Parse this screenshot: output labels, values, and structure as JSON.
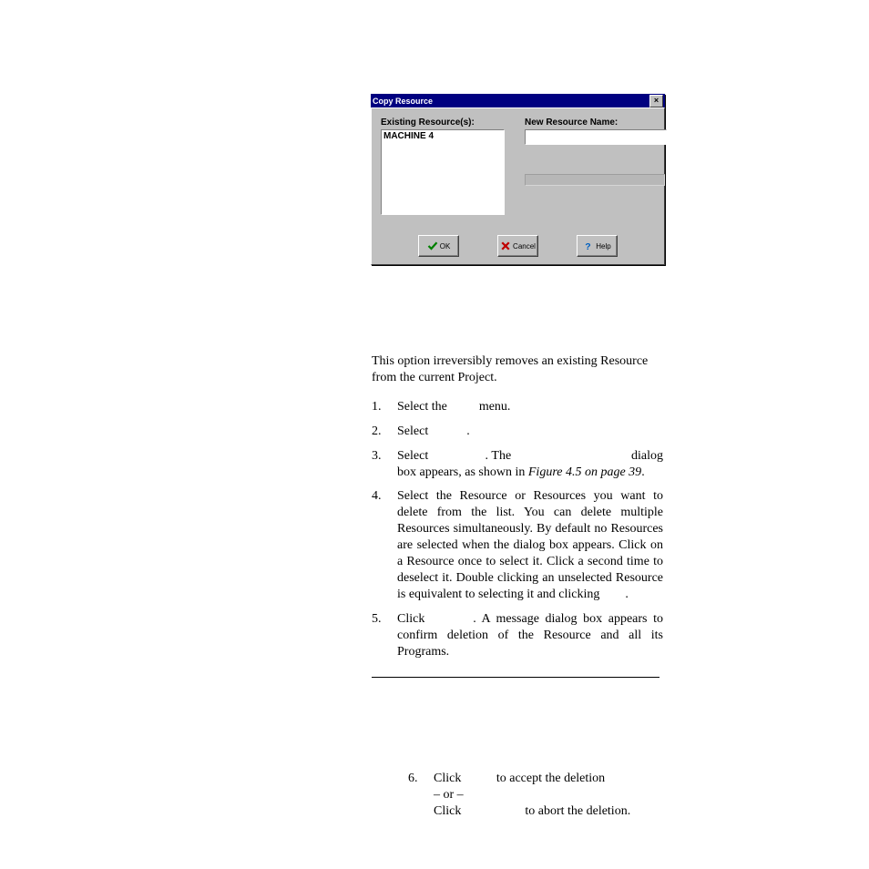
{
  "dialog": {
    "title": "Copy Resource",
    "close_glyph": "×",
    "labels": {
      "existing": "Existing Resource(s):",
      "newname": "New Resource Name:"
    },
    "list_items": [
      "MACHINE 4"
    ],
    "new_name_value": "",
    "buttons": {
      "ok": "OK",
      "cancel": "Cancel",
      "help": "Help"
    }
  },
  "intro": "This option irreversibly removes an existing Resource from the current Project.",
  "steps": {
    "s1_a": "Select the ",
    "s1_b": " menu.",
    "s2_a": "Select ",
    "s2_b": ".",
    "s3_a": "Select ",
    "s3_b": ". The ",
    "s3_c": " dialog box appears, as shown in ",
    "s3_ref": "Figure 4.5 on page 39",
    "s3_d": ".",
    "s4": "Select the Resource or Resources you want to delete from the list. You can delete multiple Resources simultaneously. By default no Resources are selected when the dialog box appears. Click on a Resource once to select it. Click a second time to deselect it. Double clicking an unselected Resource is equivalent to selecting it and clicking ",
    "s4_b": ".",
    "s5_a": "Click ",
    "s5_b": ". A message dialog box appears to confirm deletion of the Resource and all its Programs.",
    "s6_a": "Click ",
    "s6_b": " to accept the deletion",
    "s6_or": "– or –",
    "s6_c": "Click ",
    "s6_d": " to abort the deletion."
  },
  "nums": {
    "n1": "1.",
    "n2": "2.",
    "n3": "3.",
    "n4": "4.",
    "n5": "5.",
    "n6": "6."
  },
  "gaps": {
    "g1": "        ",
    "g2": "           ",
    "g3a": "                ",
    "g3b": "                                  ",
    "g4": "       ",
    "g5": "       ",
    "g6a": "         ",
    "g6c": "                  "
  }
}
